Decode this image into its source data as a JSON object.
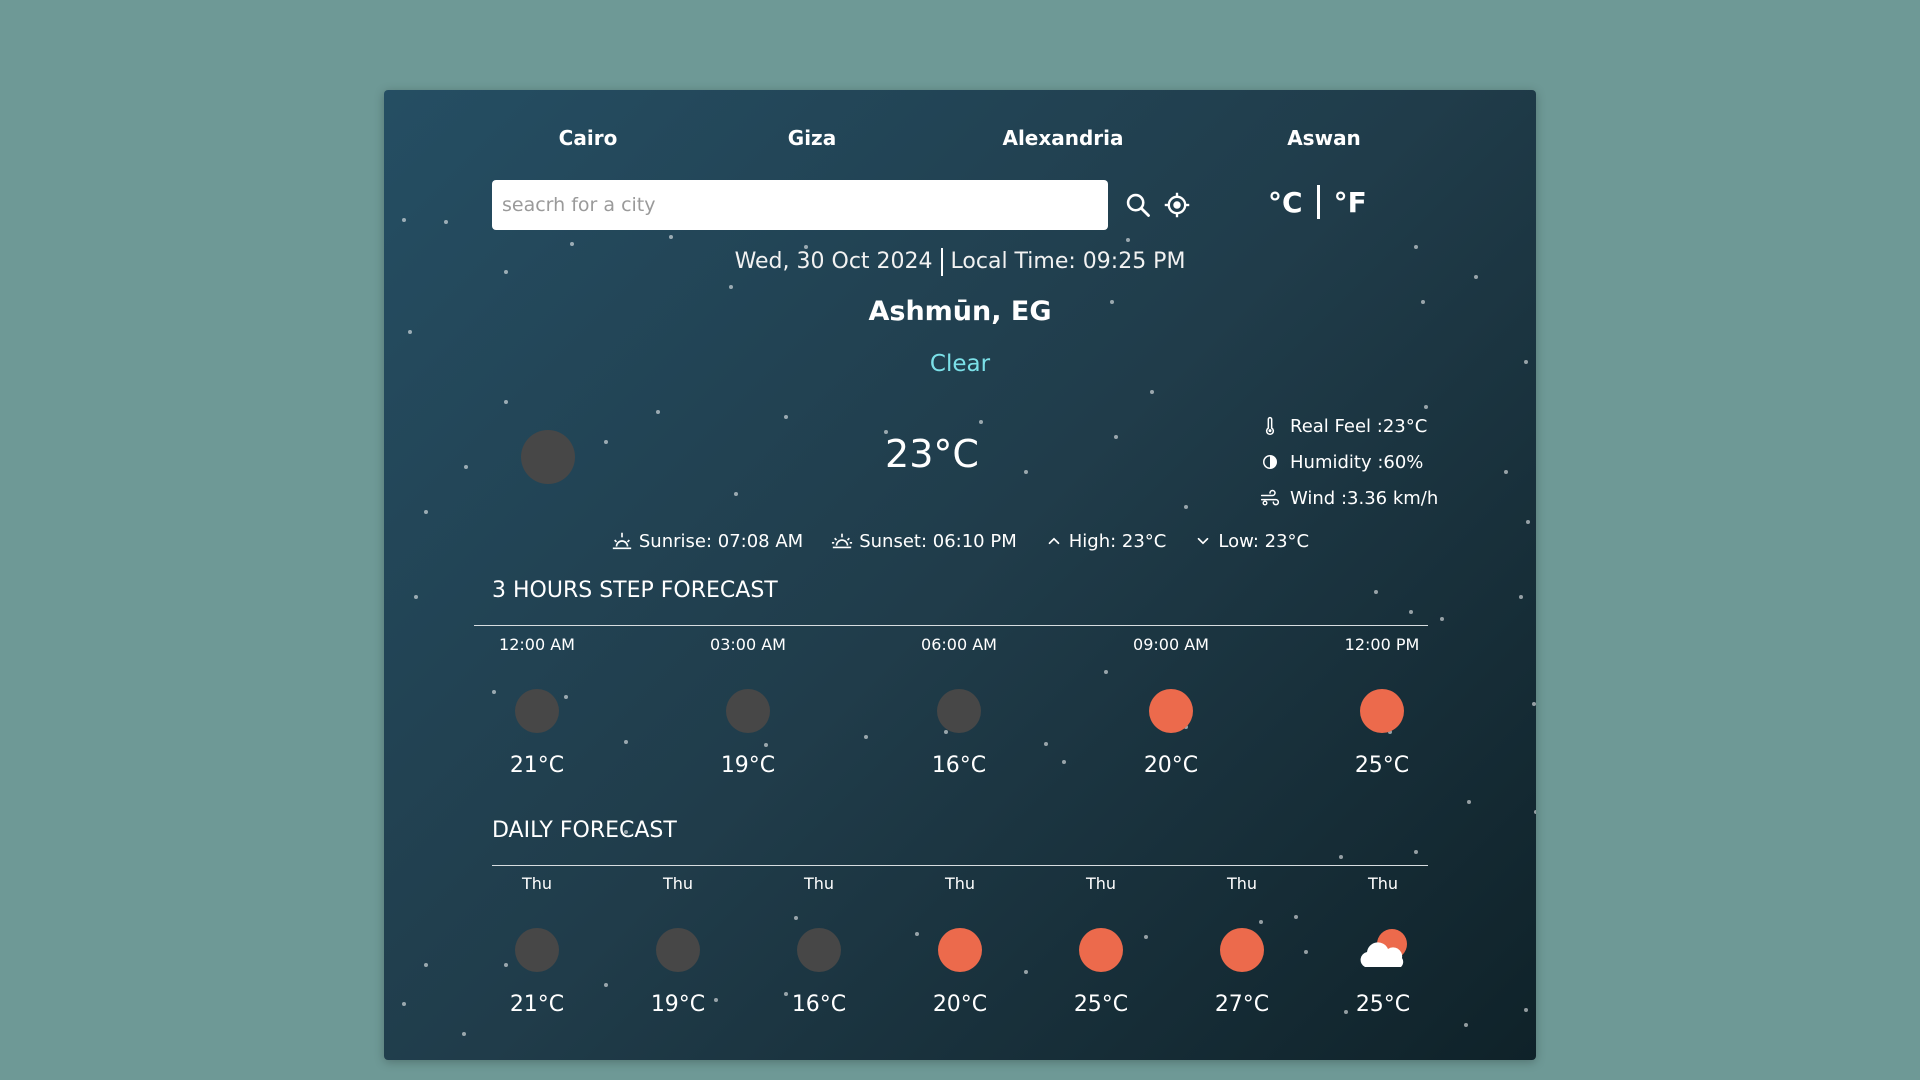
{
  "cities": [
    "Cairo",
    "Giza",
    "Alexandria",
    "Aswan"
  ],
  "search": {
    "placeholder": "seacrh for a city",
    "value": ""
  },
  "units": {
    "celsius": "°C",
    "fahrenheit": "°F"
  },
  "current": {
    "date": "Wed, 30 Oct 2024",
    "local_time": "Local Time: 09:25 PM",
    "location": "Ashmūn, EG",
    "condition": "Clear",
    "temp": "23°C",
    "icon": "moon-night-icon",
    "real_feel": "Real Feel :23°C",
    "humidity": "Humidity :60%",
    "wind": "Wind :3.36 km/h",
    "sunrise": "Sunrise: 07:08 AM",
    "sunset": "Sunset: 06:10 PM",
    "high": "High: 23°C",
    "low": "Low: 23°C"
  },
  "hourly": {
    "title": "3 HOURS STEP FORECAST",
    "items": [
      {
        "label": "12:00 AM",
        "temp": "21°C",
        "icon": "night"
      },
      {
        "label": "03:00 AM",
        "temp": "19°C",
        "icon": "night"
      },
      {
        "label": "06:00 AM",
        "temp": "16°C",
        "icon": "night"
      },
      {
        "label": "09:00 AM",
        "temp": "20°C",
        "icon": "day"
      },
      {
        "label": "12:00 PM",
        "temp": "25°C",
        "icon": "day"
      }
    ]
  },
  "daily": {
    "title": "DAILY FORECAST",
    "items": [
      {
        "label": "Thu",
        "temp": "21°C",
        "icon": "night"
      },
      {
        "label": "Thu",
        "temp": "19°C",
        "icon": "night"
      },
      {
        "label": "Thu",
        "temp": "16°C",
        "icon": "night"
      },
      {
        "label": "Thu",
        "temp": "20°C",
        "icon": "day"
      },
      {
        "label": "Thu",
        "temp": "25°C",
        "icon": "day"
      },
      {
        "label": "Thu",
        "temp": "27°C",
        "icon": "day"
      },
      {
        "label": "Thu",
        "temp": "25°C",
        "icon": "cloud-sun"
      }
    ]
  },
  "colors": {
    "background": "#6e9996",
    "sun": "#ec6a4c",
    "moon": "#474747",
    "condition_text": "#7be0e8"
  }
}
